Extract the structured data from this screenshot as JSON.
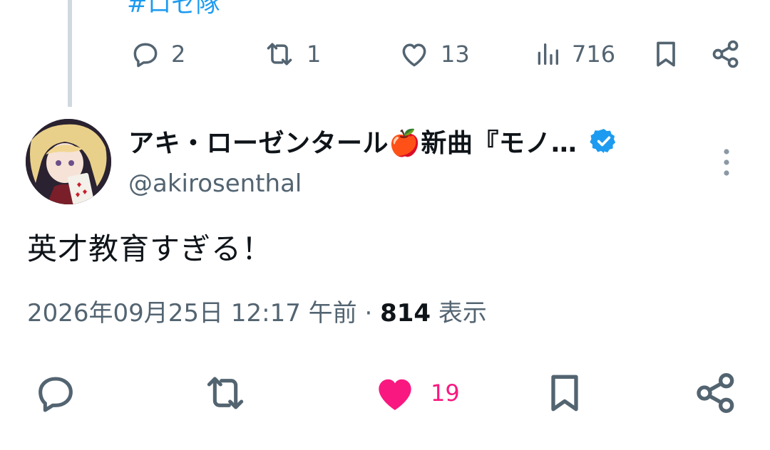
{
  "previous_tweet": {
    "hashtag": "#ロゼ隊",
    "actions": {
      "reply_count": "2",
      "retweet_count": "1",
      "like_count": "13",
      "view_count": "716"
    }
  },
  "tweet": {
    "display_name": "アキ・ローゼンタール🍎新曲『モノ…",
    "handle": "@akirosenthal",
    "text": "英才教育すぎる！",
    "timestamp": "2026年09月25日 12:17 午前",
    "separator": "·",
    "views": "814",
    "views_label": "表示",
    "like_count": "19",
    "liked": true
  },
  "icons": {
    "reply": "reply-icon",
    "retweet": "retweet-icon",
    "like": "heart-icon",
    "views": "analytics-icon",
    "bookmark": "bookmark-icon",
    "share": "share-icon",
    "more": "more-vertical-icon",
    "verified": "verified-badge-icon"
  },
  "colors": {
    "accent": "#1d9bf0",
    "like": "#f91880",
    "muted": "#536471",
    "text": "#0f1419",
    "thread_line": "#cfd9de"
  }
}
